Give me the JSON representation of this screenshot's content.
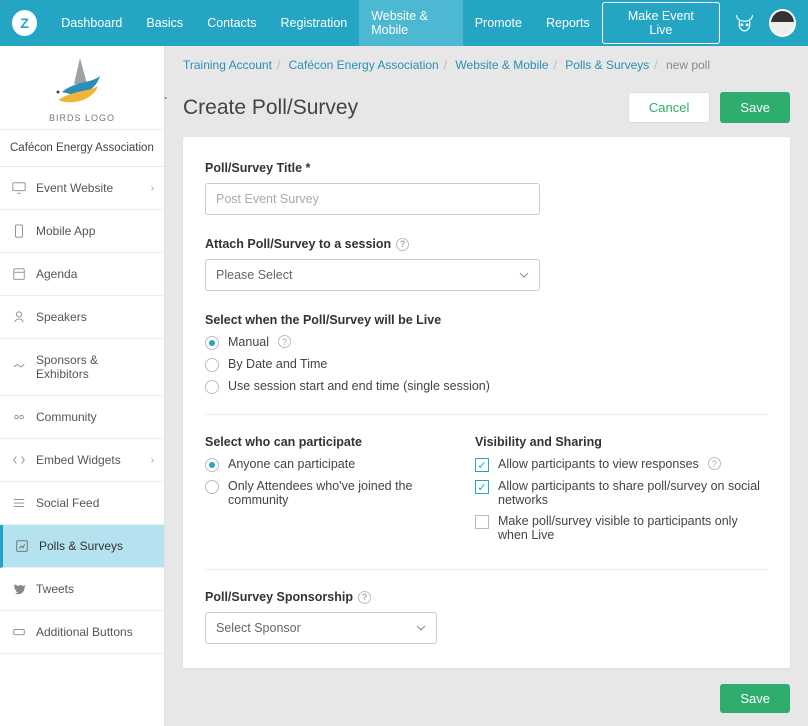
{
  "topnav": {
    "items": [
      {
        "label": "Dashboard"
      },
      {
        "label": "Basics"
      },
      {
        "label": "Contacts"
      },
      {
        "label": "Registration"
      },
      {
        "label": "Website & Mobile",
        "active": true
      },
      {
        "label": "Promote"
      },
      {
        "label": "Reports"
      }
    ],
    "live_button": "Make Event Live"
  },
  "sidebar": {
    "logo_text": "BIRDS LOGO",
    "org_name": "Cafécon Energy Association",
    "items": [
      {
        "label": "Event Website",
        "expandable": true
      },
      {
        "label": "Mobile App"
      },
      {
        "label": "Agenda"
      },
      {
        "label": "Speakers"
      },
      {
        "label": "Sponsors & Exhibitors"
      },
      {
        "label": "Community"
      },
      {
        "label": "Embed Widgets",
        "expandable": true
      },
      {
        "label": "Social Feed"
      },
      {
        "label": "Polls & Surveys",
        "active": true
      },
      {
        "label": "Tweets"
      },
      {
        "label": "Additional Buttons"
      }
    ]
  },
  "breadcrumbs": {
    "items": [
      "Training Account",
      "Cafécon Energy Association",
      "Website & Mobile",
      "Polls & Surveys"
    ],
    "current": "new poll"
  },
  "page": {
    "title": "Create Poll/Survey",
    "cancel": "Cancel",
    "save": "Save"
  },
  "form": {
    "title_label": "Poll/Survey Title *",
    "title_placeholder": "Post Event Survey",
    "attach_label": "Attach Poll/Survey to a session",
    "attach_value": "Please Select",
    "live_label": "Select when the Poll/Survey will be Live",
    "live_options": [
      "Manual",
      "By Date and Time",
      "Use session start and end time (single session)"
    ],
    "participate_label": "Select who can participate",
    "participate_options": [
      "Anyone can participate",
      "Only Attendees who've joined the community"
    ],
    "visibility_label": "Visibility and Sharing",
    "visibility_options": [
      "Allow participants to view responses",
      "Allow participants to share poll/survey on social networks",
      "Make poll/survey visible to participants only when Live"
    ],
    "sponsorship_label": "Poll/Survey Sponsorship",
    "sponsorship_value": "Select Sponsor"
  }
}
